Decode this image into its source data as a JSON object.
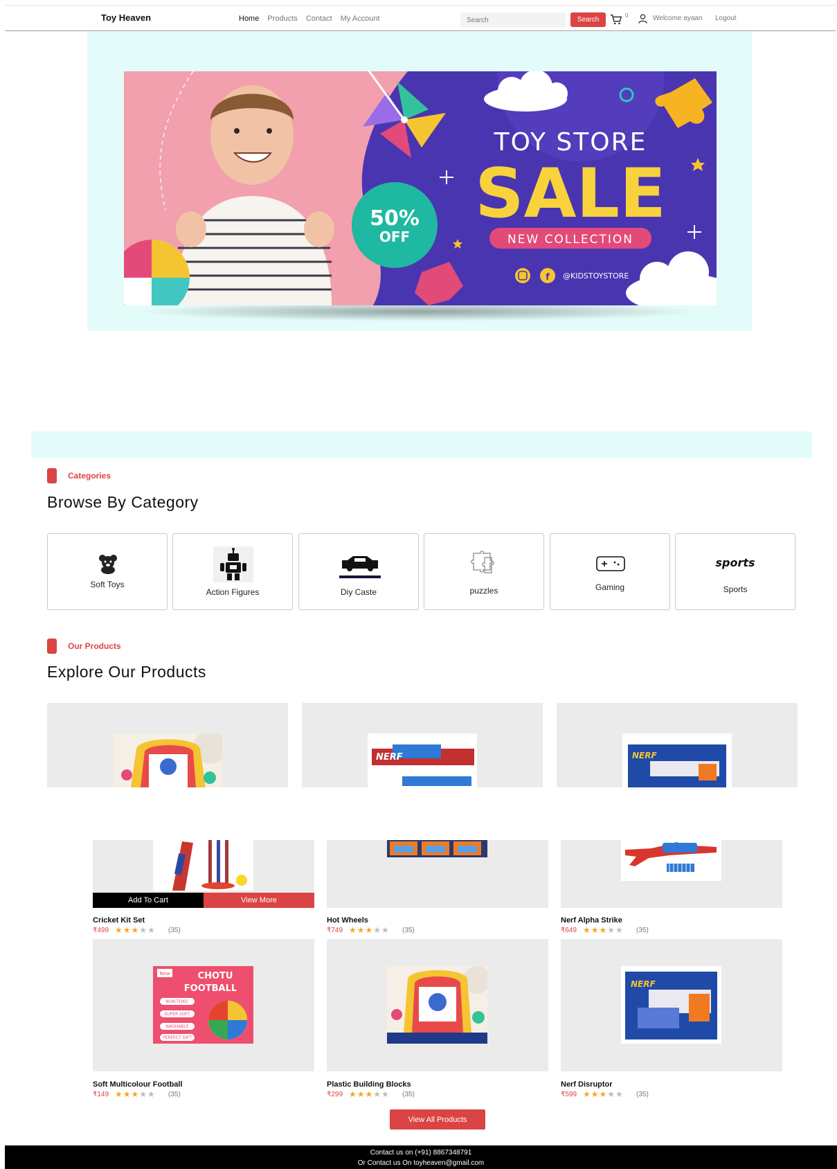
{
  "header": {
    "brand": "Toy Heaven",
    "nav": [
      "Home",
      "Products",
      "Contact",
      "My Account"
    ],
    "search_placeholder": "Search",
    "search_button": "Search",
    "cart_count": "0",
    "welcome": "Welcome ayaan",
    "logout": "Logout"
  },
  "banner": {
    "line1": "TOY STORE",
    "line2": "SALE",
    "discount_value": "50%",
    "discount_word": "OFF",
    "collection": "NEW COLLECTION",
    "handle": "@KIDSTOYSTORE"
  },
  "categories_section": {
    "label": "Categories",
    "title": "Browse By Category",
    "items": [
      "Soft Toys",
      "Action Figures",
      "Diy Caste",
      "puzzles",
      "Gaming",
      "Sports"
    ],
    "sports_logo": "sports"
  },
  "products_section": {
    "label": "Our Products",
    "title": "Explore Our Products",
    "add_to_cart": "Add To Cart",
    "view_more": "View More",
    "view_all": "View All Products",
    "products": [
      {
        "name": "Cricket Kit Set",
        "price": "₹499",
        "rating": 3,
        "reviews": "(35)"
      },
      {
        "name": "Hot Wheels",
        "price": "₹749",
        "rating": 3,
        "reviews": "(35)"
      },
      {
        "name": "Nerf Alpha Strike",
        "price": "₹649",
        "rating": 3,
        "reviews": "(35)"
      },
      {
        "name": "Soft Multicolour Football",
        "price": "₹149",
        "rating": 3,
        "reviews": "(35)"
      },
      {
        "name": "Plastic Building Blocks",
        "price": "₹299",
        "rating": 3,
        "reviews": "(35)"
      },
      {
        "name": "Nerf Disruptor",
        "price": "₹599",
        "rating": 3,
        "reviews": "(35)"
      }
    ],
    "football_art": {
      "badge": "New",
      "line1": "CHOTU",
      "line2": "FOOTBALL",
      "tags": [
        "NON-TOXIC",
        "SUPER SOFT",
        "WASHABLE",
        "PERFECT GIFT"
      ]
    },
    "nerf_brand": "NERF"
  },
  "footer": {
    "line1": "Contact us on (+91) 8867348791",
    "line2": "Or Contact us On toyheaven@gmail.com"
  },
  "colors": {
    "accent": "#db4444",
    "banner_bg": "#4a35b0",
    "hero_bg": "#e3fcfa",
    "star": "#f5a623"
  }
}
